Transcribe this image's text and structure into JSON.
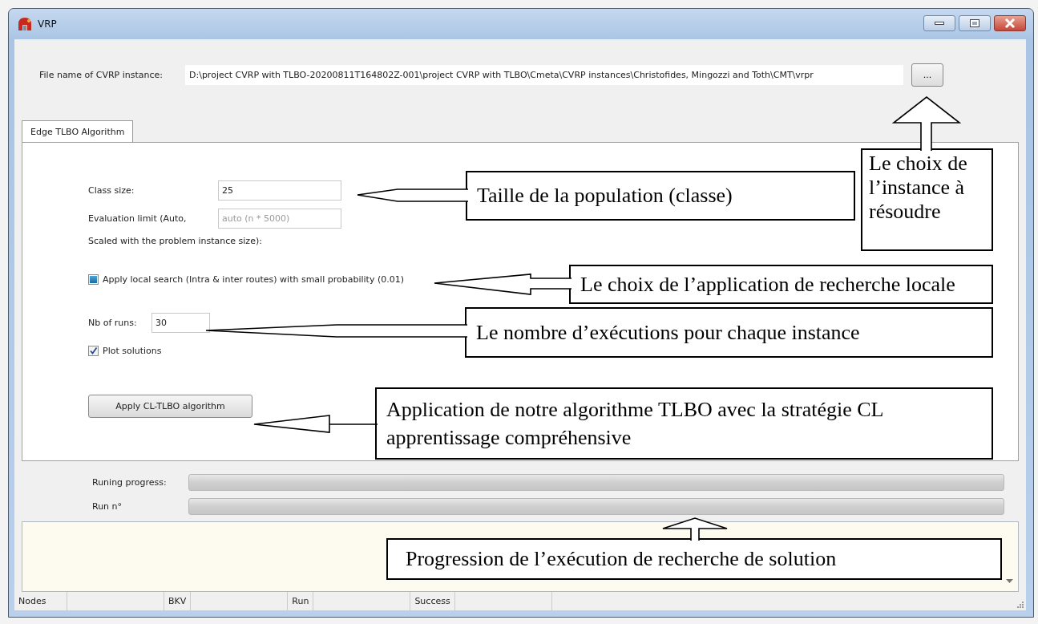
{
  "window": {
    "title": "VRP"
  },
  "file_field": {
    "label": "File name of CVRP instance:",
    "value": "D:\\project CVRP with TLBO-20200811T164802Z-001\\project CVRP with TLBO\\Cmeta\\CVRP instances\\Christofides, Mingozzi and Toth\\CMT\\vrpr",
    "browse_button": "..."
  },
  "tabs": [
    {
      "label": "Edge TLBO Algorithm",
      "selected": true
    }
  ],
  "panel_items": [
    {
      "kind": "field",
      "label": "Class size:",
      "value": "25"
    },
    {
      "kind": "field",
      "label": "Evaluation limit (Auto,",
      "placeholder": "auto (n * 5000)"
    },
    {
      "kind": "note",
      "text": "Scaled with the problem instance size):"
    },
    {
      "kind": "checkbox",
      "label": "Apply local search (Intra & inter routes) with small probability (0.01)",
      "checked": true,
      "partial": true
    },
    {
      "kind": "short_field",
      "label": "Nb of runs:",
      "value": "30"
    },
    {
      "kind": "checkbox",
      "label": "Plot solutions",
      "checked": true
    },
    {
      "kind": "button",
      "label": "Apply CL-TLBO algorithm"
    }
  ],
  "progress": [
    {
      "label": "Runing progress:",
      "level": 0
    },
    {
      "label": "Run n°",
      "level": 0
    }
  ],
  "status_bar": [
    "Nodes",
    "BKV",
    "Run",
    "Success"
  ],
  "callouts": [
    {
      "text": "Taille de la population (classe)"
    },
    {
      "text": "Le choix de l’instance à résoudre"
    },
    {
      "text": "Le choix de l’application de recherche locale"
    },
    {
      "text": "Le nombre d’exécutions pour chaque instance"
    },
    {
      "text": "Application de notre algorithme TLBO avec la stratégie CL apprentissage compréhensive"
    },
    {
      "text": "Progression de l’exécution de recherche de solution"
    }
  ]
}
